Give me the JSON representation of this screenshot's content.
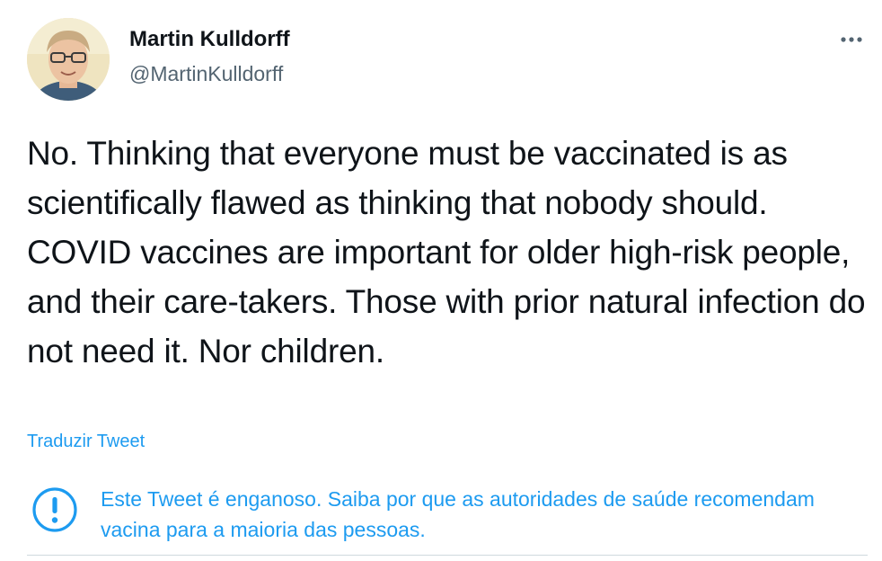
{
  "author": {
    "display_name": "Martin Kulldorff",
    "handle": "@MartinKulldorff"
  },
  "tweet": {
    "text": "No. Thinking that everyone must be vaccinated is as scientifically flawed as thinking that nobody should. COVID vaccines are important for older high-risk people, and their care-takers. Those with prior natural infection do not need it. Nor children.",
    "translate_label": "Traduzir Tweet"
  },
  "warning": {
    "text": "Este Tweet é enganoso. Saiba por que as autoridades de saúde recomendam vacina para a maioria das pessoas.",
    "icon": "exclamation-circle-icon"
  },
  "icons": {
    "more": "more-options-icon",
    "avatar": "avatar"
  },
  "colors": {
    "link": "#1d9bf0",
    "text": "#0f1419",
    "secondary": "#536471",
    "divider": "#cfd9de"
  }
}
